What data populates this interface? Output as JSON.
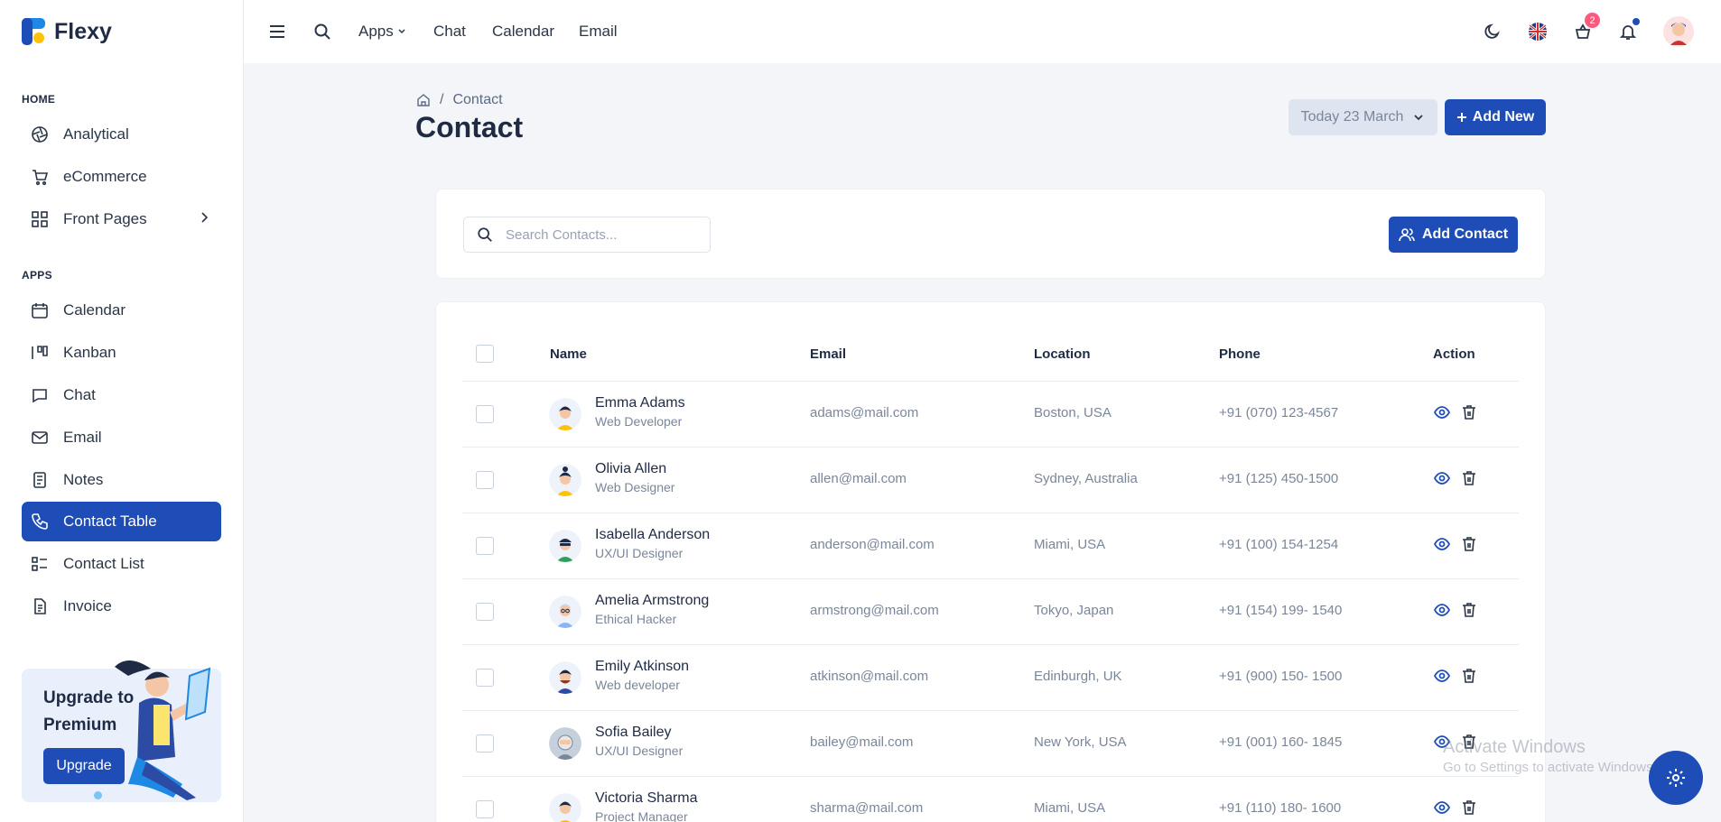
{
  "brand": {
    "name": "Flexy"
  },
  "sidebar": {
    "sections": [
      {
        "label": "HOME"
      },
      {
        "label": "APPS"
      }
    ],
    "items": [
      {
        "label": "Analytical",
        "icon": "aperture-icon"
      },
      {
        "label": "eCommerce",
        "icon": "cart-icon"
      },
      {
        "label": "Front Pages",
        "icon": "grid-icon"
      },
      {
        "label": "Calendar",
        "icon": "calendar-icon"
      },
      {
        "label": "Kanban",
        "icon": "kanban-icon"
      },
      {
        "label": "Chat",
        "icon": "chat-icon"
      },
      {
        "label": "Email",
        "icon": "mail-icon"
      },
      {
        "label": "Notes",
        "icon": "notes-icon"
      },
      {
        "label": "Contact Table",
        "icon": "phone-icon",
        "active": true
      },
      {
        "label": "Contact List",
        "icon": "list-icon"
      },
      {
        "label": "Invoice",
        "icon": "invoice-icon"
      }
    ],
    "upgrade": {
      "title": "Upgrade to Premium",
      "button": "Upgrade"
    }
  },
  "topbar": {
    "menu": [
      "Apps",
      "Chat",
      "Calendar",
      "Email"
    ],
    "cart_badge": "2"
  },
  "page": {
    "breadcrumb": "Contact",
    "title": "Contact",
    "date_label": "Today 23 March",
    "add_new": "Add New"
  },
  "search": {
    "placeholder": "Search Contacts...",
    "add_contact": "Add Contact"
  },
  "table": {
    "headers": [
      "Name",
      "Email",
      "Location",
      "Phone",
      "Action"
    ],
    "rows": [
      {
        "name": "Emma Adams",
        "role": "Web Developer",
        "email": "adams@mail.com",
        "location": "Boston, USA",
        "phone": "+91 (070) 123-4567"
      },
      {
        "name": "Olivia Allen",
        "role": "Web Designer",
        "email": "allen@mail.com",
        "location": "Sydney, Australia",
        "phone": "+91 (125) 450-1500"
      },
      {
        "name": "Isabella Anderson",
        "role": "UX/UI Designer",
        "email": "anderson@mail.com",
        "location": "Miami, USA",
        "phone": "+91 (100) 154-1254"
      },
      {
        "name": "Amelia Armstrong",
        "role": "Ethical Hacker",
        "email": "armstrong@mail.com",
        "location": "Tokyo, Japan",
        "phone": "+91 (154) 199- 1540"
      },
      {
        "name": "Emily Atkinson",
        "role": "Web developer",
        "email": "atkinson@mail.com",
        "location": "Edinburgh, UK",
        "phone": "+91 (900) 150- 1500"
      },
      {
        "name": "Sofia Bailey",
        "role": "UX/UI Designer",
        "email": "bailey@mail.com",
        "location": "New York, USA",
        "phone": "+91 (001) 160- 1845"
      },
      {
        "name": "Victoria Sharma",
        "role": "Project Manager",
        "email": "sharma@mail.com",
        "location": "Miami, USA",
        "phone": "+91 (110) 180- 1600"
      }
    ]
  },
  "watermark": {
    "line1": "Activate Windows",
    "line2": "Go to Settings to activate Windows."
  },
  "colors": {
    "primary": "#1e4db7",
    "badge": "#fa5a7d"
  }
}
